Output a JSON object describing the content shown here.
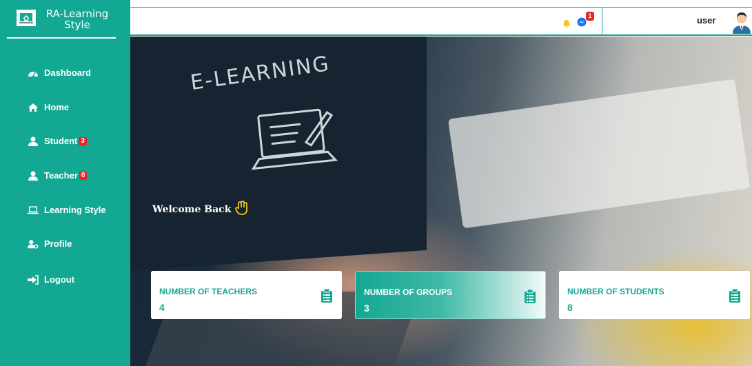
{
  "brand": {
    "title": "RA-Learning Style"
  },
  "sidebar": {
    "items": [
      {
        "label": "Dashboard",
        "icon": "dashboard-icon"
      },
      {
        "label": "Home",
        "icon": "home-icon"
      },
      {
        "label": "Student",
        "icon": "user-icon",
        "badge": "3"
      },
      {
        "label": "Teacher",
        "icon": "user-icon",
        "badge": "0"
      },
      {
        "label": "Learning Style",
        "icon": "laptop-icon"
      },
      {
        "label": "Profile",
        "icon": "user-cog-icon"
      },
      {
        "label": "Logout",
        "icon": "sign-out-icon"
      }
    ]
  },
  "topbar": {
    "message_badge": "1",
    "username": "user"
  },
  "hero": {
    "banner_text": "E-LEARNING",
    "welcome": "Welcome Back"
  },
  "stats": [
    {
      "label": "NUMBER OF TEACHERS",
      "value": "4"
    },
    {
      "label": "NUMBER OF GROUPS",
      "value": "3"
    },
    {
      "label": "NUMBER OF STUDENTS",
      "value": "8"
    }
  ],
  "colors": {
    "accent": "#13a893",
    "badge": "#e8262a",
    "bell": "#f5c518"
  }
}
